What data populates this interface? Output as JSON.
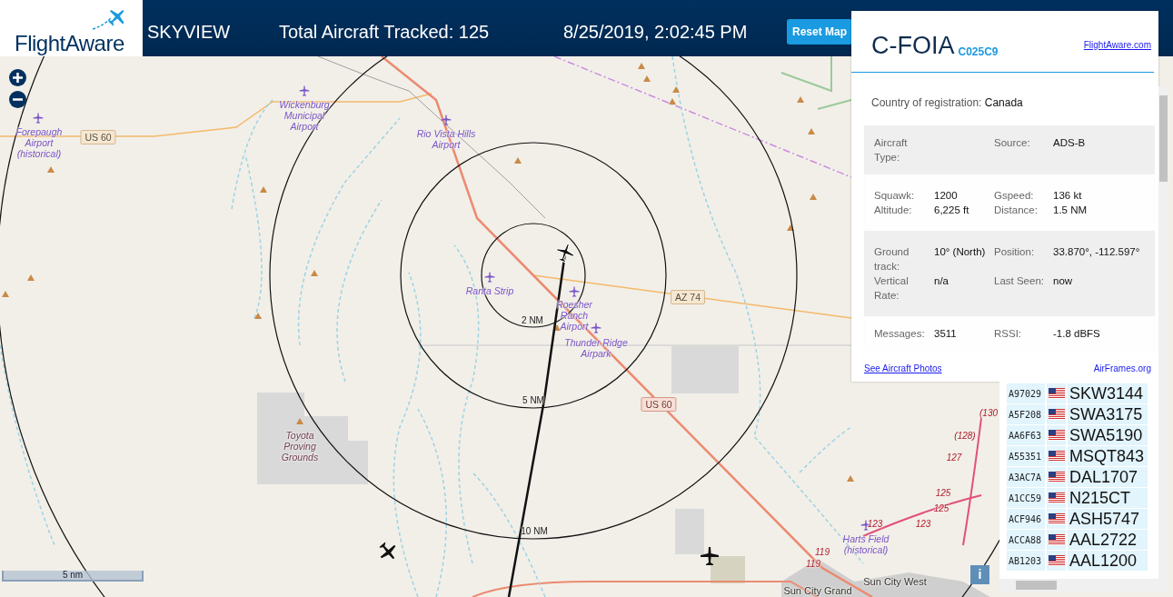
{
  "header": {
    "logo": "FlightAware",
    "app_title": "SKYVIEW",
    "total_tracked": "Total Aircraft Tracked: 125",
    "datetime": "8/25/2019, 2:02:45 PM",
    "reset_button": "Reset Map"
  },
  "map": {
    "labels": [
      {
        "kind": "airport",
        "text": "Forepaugh Airport (historical)"
      },
      {
        "kind": "airport",
        "text": "Wickenburg Municipal Airport"
      },
      {
        "kind": "airport",
        "text": "Rio Vista Hills Airport"
      },
      {
        "kind": "airport",
        "text": "Ranta Strip"
      },
      {
        "kind": "airport",
        "text": "Roesher Ranch Airport"
      },
      {
        "kind": "airport",
        "text": "Thunder Ridge Airpark"
      },
      {
        "kind": "area",
        "text": "Toyota Proving Grounds"
      },
      {
        "kind": "airport",
        "text": "Harts Field (historical)"
      },
      {
        "kind": "place",
        "text": "Sun City West"
      },
      {
        "kind": "place",
        "text": "Sun City Grand"
      },
      {
        "kind": "shield",
        "text": "US 60"
      },
      {
        "kind": "shield",
        "text": "AZ 74"
      },
      {
        "kind": "shield_red",
        "text": "US 60"
      },
      {
        "kind": "ring",
        "text": "2 NM"
      },
      {
        "kind": "ring",
        "text": "5 NM"
      },
      {
        "kind": "ring",
        "text": "10 NM"
      },
      {
        "kind": "route",
        "text": "119"
      },
      {
        "kind": "route",
        "text": "119"
      },
      {
        "kind": "route",
        "text": "123"
      },
      {
        "kind": "route",
        "text": "123"
      },
      {
        "kind": "route",
        "text": "125"
      },
      {
        "kind": "route",
        "text": "125"
      },
      {
        "kind": "route",
        "text": "127"
      },
      {
        "kind": "route",
        "text": "(128)"
      },
      {
        "kind": "route",
        "text": "(130"
      }
    ],
    "aircraft": [
      {
        "selected": true
      },
      {
        "selected": false
      },
      {
        "selected": false
      }
    ],
    "scale": "5 nm",
    "info_button": "i"
  },
  "details": {
    "registration": "C-FOIA",
    "hex": "C025C9",
    "link": "FlightAware.com",
    "country_label": "Country of registration:",
    "country": "Canada",
    "groups": [
      {
        "shaded": true,
        "items": [
          {
            "label": "Aircraft Type:"
          },
          {
            "label": "Source:",
            "value": "ADS-B"
          }
        ]
      },
      {
        "shaded": false,
        "items": [
          {
            "label": "Squawk:",
            "value": "1200"
          },
          {
            "label": "Gspeed:",
            "value": "136 kt"
          },
          {
            "label": "Altitude:",
            "value": "6,225 ft"
          },
          {
            "label": "Distance:",
            "value": "1.5 NM"
          }
        ]
      },
      {
        "shaded": true,
        "items": [
          {
            "label": "Ground track:",
            "value": "10° (North)"
          },
          {
            "label": "Position:",
            "value": "33.870°, -112.597°"
          },
          {
            "label": "Vertical Rate:",
            "value": "n/a"
          },
          {
            "label": "Last Seen:",
            "value": "now"
          }
        ]
      },
      {
        "shaded": false,
        "items": [
          {
            "label": "Messages:",
            "value": "3511"
          },
          {
            "label": "RSSI:",
            "value": "-1.8 dBFS"
          }
        ]
      }
    ],
    "photos_link": "See Aircraft Photos",
    "airframes_link": "AirFrames.org"
  },
  "aircraft_list": [
    {
      "hex": "A97029",
      "callsign": "SKW3144"
    },
    {
      "hex": "A5F208",
      "callsign": "SWA3175"
    },
    {
      "hex": "AA6F63",
      "callsign": "SWA5190"
    },
    {
      "hex": "A55351",
      "callsign": "MSQT843"
    },
    {
      "hex": "A3AC7A",
      "callsign": "DAL1707"
    },
    {
      "hex": "A1CC59",
      "callsign": "N215CT"
    },
    {
      "hex": "ACF946",
      "callsign": "ASH5747"
    },
    {
      "hex": "ACCA88",
      "callsign": "AAL2722"
    },
    {
      "hex": "AB1203",
      "callsign": "AAL1200"
    }
  ]
}
